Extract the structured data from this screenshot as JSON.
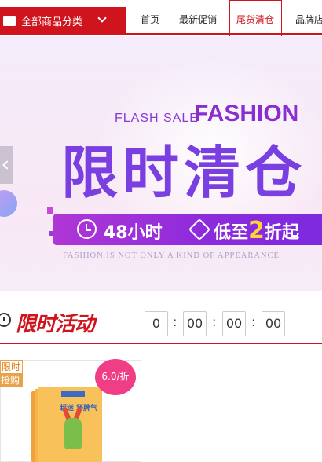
{
  "nav": {
    "category_label": "全部商品分类",
    "items": [
      "首页",
      "最新促销",
      "尾货清仓",
      "品牌店"
    ],
    "active_index": 2
  },
  "banner": {
    "flash_sale": "FLASH SALE",
    "fashion": "FASHION",
    "main_title": "限时清仓",
    "hours_text": "48小时",
    "discount_prefix": "低至",
    "discount_number": "2",
    "discount_suffix": "折起",
    "slogan": "FASHION IS NOT ONLY A KIND OF APPEARANCE"
  },
  "activity": {
    "title": "限时活动",
    "countdown": [
      "0",
      "00",
      "00",
      "00"
    ],
    "separator": ":"
  },
  "product": {
    "badge_line1": "限时",
    "badge_line2": "抢购",
    "discount_label": "6.0/折",
    "book_title": "超迷 坏脾气"
  },
  "colors": {
    "brand_red": "#d0141e",
    "purple": "#8a2ed0",
    "badge_orange": "#e8a24a",
    "discount_pink": "#ef3d86"
  }
}
